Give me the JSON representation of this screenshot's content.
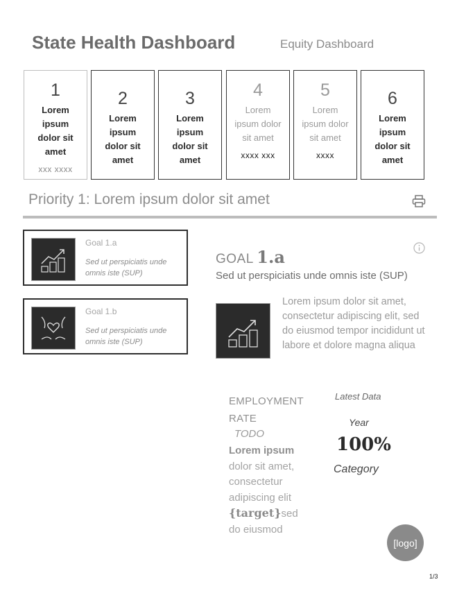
{
  "header": {
    "title": "State Health Dashboard",
    "subtitle": "Equity Dashboard"
  },
  "priorities": [
    {
      "number": "1",
      "label": "Lorem ipsum dolor sit amet",
      "meta": "xxx   xxxx",
      "state": "active"
    },
    {
      "number": "2",
      "label": "Lorem ipsum dolor sit amet",
      "meta": "",
      "state": "normal"
    },
    {
      "number": "3",
      "label": "Lorem ipsum dolor sit amet",
      "meta": "",
      "state": "normal"
    },
    {
      "number": "4",
      "label": "Lorem ipsum dolor sit amet",
      "meta": "xxxx   xxx",
      "state": "dim"
    },
    {
      "number": "5",
      "label": "Lorem ipsum dolor sit amet",
      "meta": "xxxx",
      "state": "dim"
    },
    {
      "number": "6",
      "label": "Lorem ipsum dolor sit amet",
      "meta": "",
      "state": "normal"
    }
  ],
  "priority_heading": "Priority 1: Lorem ipsum dolor sit amet",
  "goals": [
    {
      "label": "Goal 1.a",
      "description": "Sed ut perspiciatis unde omnis iste (SUP)",
      "icon": "growth-coins-icon"
    },
    {
      "label": "Goal 1.b",
      "description": "Sed ut perspiciatis unde omnis iste (SUP)",
      "icon": "hands-heart-icon"
    }
  ],
  "goal_detail": {
    "word": "GOAL",
    "number": "1.a",
    "description": "Sed ut perspiciatis unde omnis iste (SUP)",
    "text": "Lorem ipsum dolor sit amet, consectetur adipiscing elit, sed do eiusmod tempor incididunt ut labore et dolore magna aliqua",
    "icon": "growth-coins-icon"
  },
  "metric": {
    "label": "EMPLOYMENT RATE",
    "todo": "TODO",
    "body_strong": "Lorem ipsum",
    "body_rest": " dolor sit amet, consectetur adipiscing elit ",
    "target": "{target}",
    "body_end": "sed do eiusmod",
    "latest_label": "Latest Data",
    "year": "Year",
    "value": "100%",
    "category": "Category"
  },
  "logo": "[logo]",
  "page": "1/3"
}
